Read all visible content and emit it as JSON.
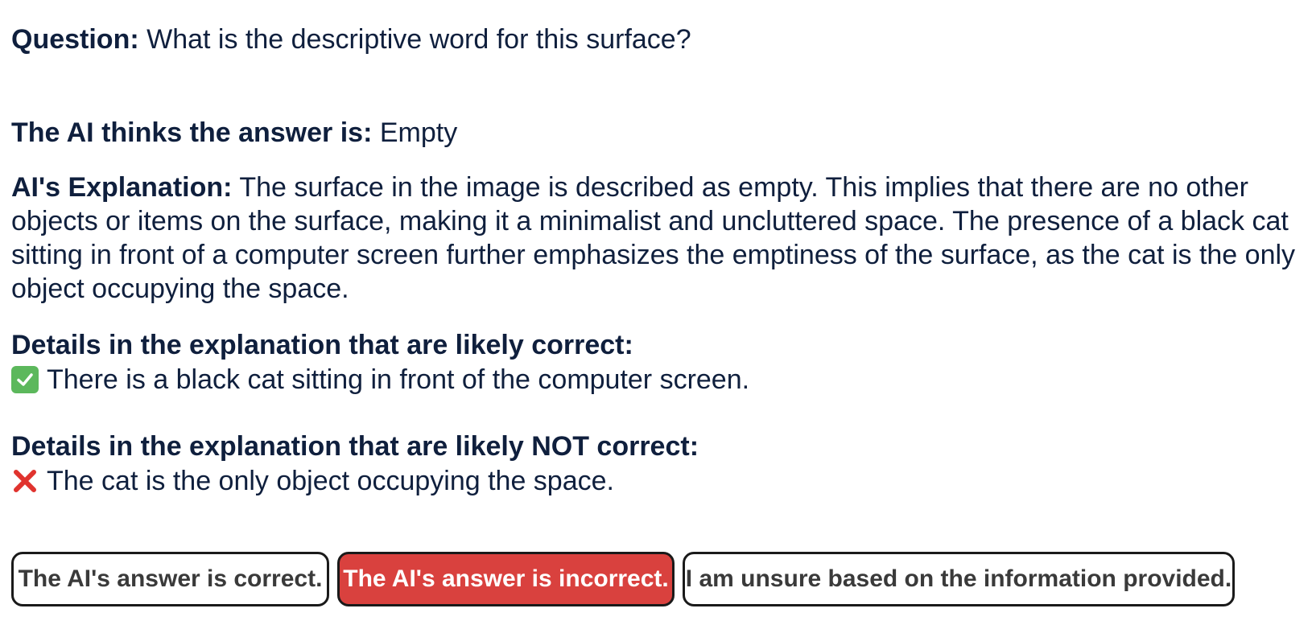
{
  "question": {
    "label": "Question:",
    "text": "What is the descriptive word for this surface?"
  },
  "ai_answer": {
    "label": "The AI thinks the answer is:",
    "text": "Empty"
  },
  "explanation": {
    "label": "AI's Explanation:",
    "text": "The surface in the image is described as empty. This implies that there are no other objects or items on the surface, making it a minimalist and uncluttered space. The presence of a black cat sitting in front of a computer screen further emphasizes the emptiness of the surface, as the cat is the only object occupying the space."
  },
  "correct_details": {
    "heading": "Details in the explanation that are likely correct:",
    "icon": "check-mark-icon",
    "items": [
      "There is a black cat sitting in front of the computer screen."
    ]
  },
  "incorrect_details": {
    "heading": "Details in the explanation that are likely NOT correct:",
    "icon": "cross-mark-icon",
    "items": [
      "The cat is the only object occupying the space."
    ]
  },
  "buttons": {
    "correct_label": "The AI's answer is correct.",
    "incorrect_label": "The AI's answer is incorrect.",
    "unsure_label": "I am unsure based on the information provided.",
    "selected": "incorrect"
  },
  "colors": {
    "text": "#0f1f3d",
    "selected_button": "#d9413e",
    "check_green": "#5cb85c",
    "cross_red": "#e0332e"
  }
}
